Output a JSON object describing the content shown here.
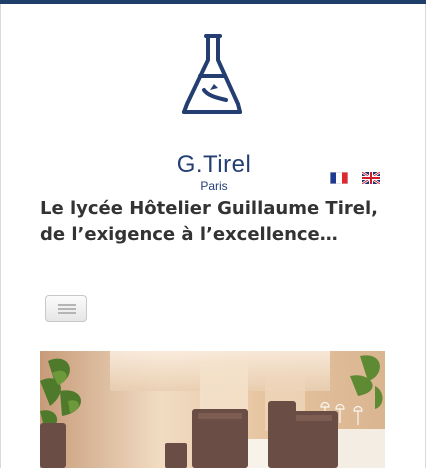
{
  "header": {
    "logo": {
      "name": "G.Tirel",
      "subtitle": "Paris"
    },
    "languages": [
      {
        "name": "french-flag-icon"
      },
      {
        "name": "uk-flag-icon"
      }
    ]
  },
  "main": {
    "headline": [
      "Le lycée Hôtelier Guillaume Tirel,",
      "de l’exigence à l’excellence…"
    ]
  },
  "nav": {
    "toggle_icon": "hamburger-icon"
  },
  "hero": {
    "alt_icon": "restaurant-photo"
  },
  "colors": {
    "accent": "#1f3f6a",
    "logo": "#243e72",
    "text": "#333333"
  }
}
